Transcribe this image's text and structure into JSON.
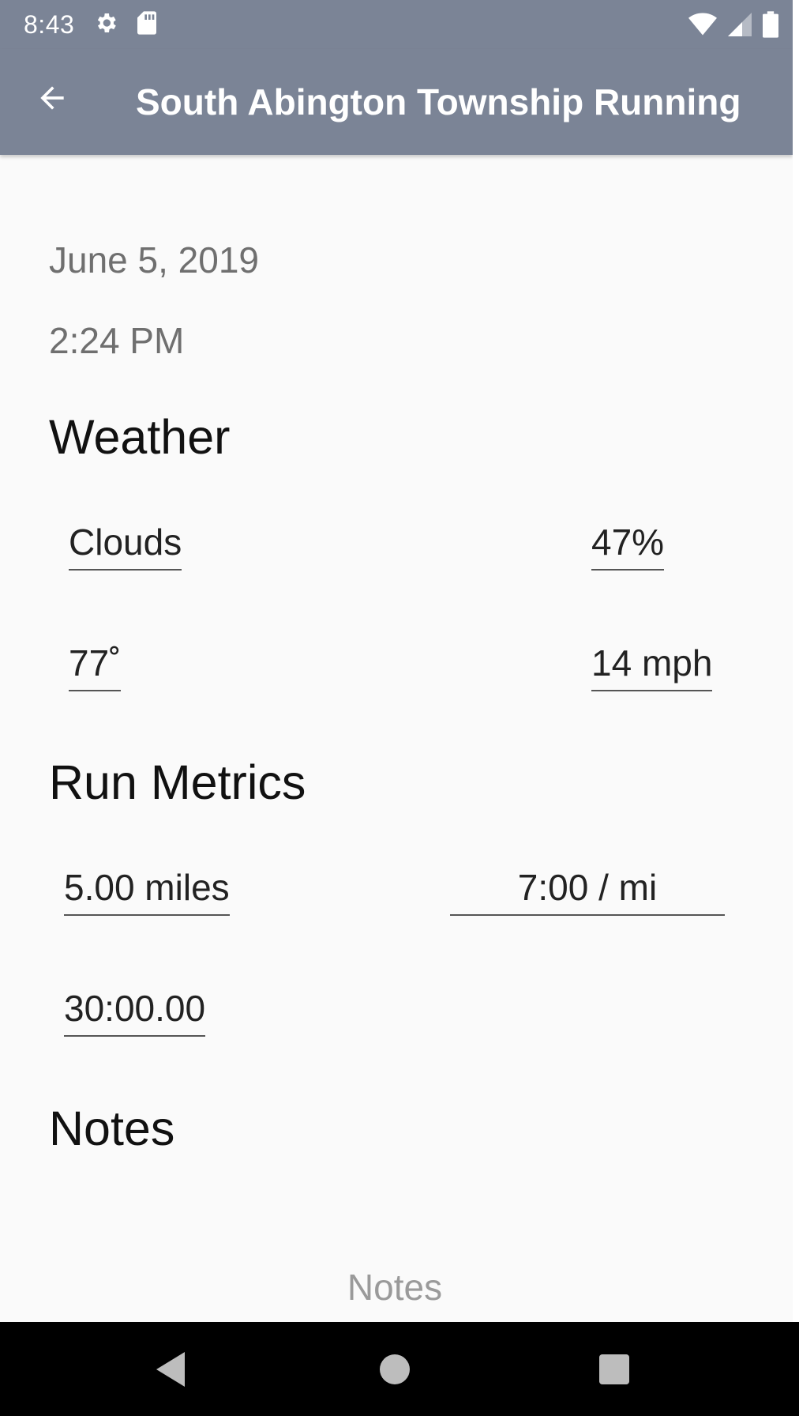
{
  "status_bar": {
    "time": "8:43",
    "icons_left": [
      "settings-icon",
      "sd-card-icon"
    ],
    "icons_right": [
      "wifi-icon",
      "signal-icon",
      "battery-icon"
    ]
  },
  "app_bar": {
    "title": "South Abington Township Running",
    "back_icon": "arrow-back-icon",
    "color": "#7b8496"
  },
  "run": {
    "date": "June 5, 2019",
    "time": "2:24 PM"
  },
  "weather": {
    "heading": "Weather",
    "condition": "Clouds",
    "humidity": "47%",
    "temperature": "77˚",
    "wind": "14 mph"
  },
  "metrics": {
    "heading": "Run Metrics",
    "distance": "5.00 miles",
    "pace": "7:00 / mi",
    "duration": "30:00.00"
  },
  "notes": {
    "heading": "Notes",
    "placeholder": "Notes"
  },
  "nav_bar": {
    "buttons": [
      "back-triangle-icon",
      "home-circle-icon",
      "recents-square-icon"
    ]
  }
}
